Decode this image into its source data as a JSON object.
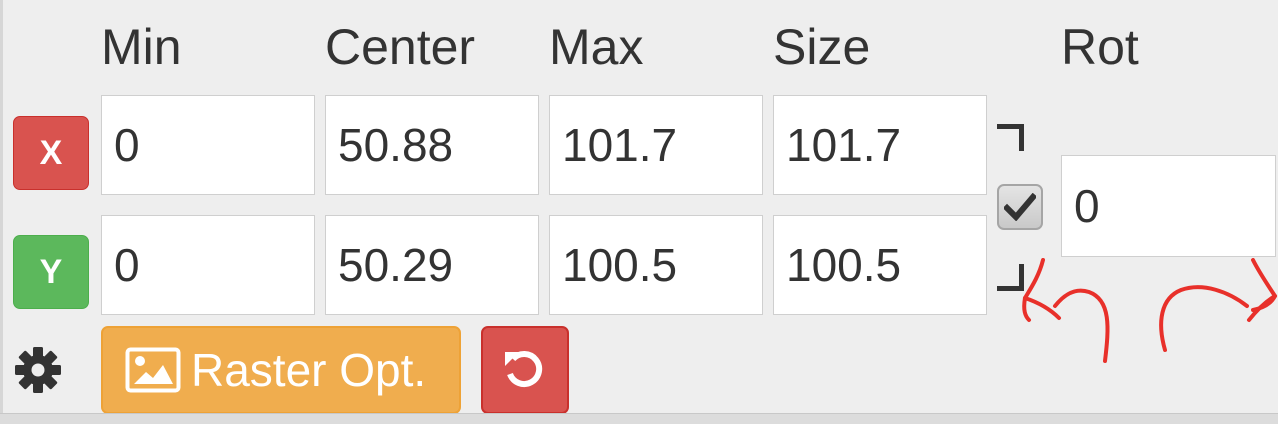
{
  "headers": {
    "min": "Min",
    "center": "Center",
    "max": "Max",
    "size": "Size",
    "rot": "Rot"
  },
  "axes": {
    "x": {
      "label": "X",
      "min": "0",
      "center": "50.88",
      "max": "101.7",
      "size": "101.7"
    },
    "y": {
      "label": "Y",
      "min": "0",
      "center": "50.29",
      "max": "100.5",
      "size": "100.5"
    }
  },
  "lock_aspect": {
    "checked": true,
    "icon": "check-icon"
  },
  "rotation": {
    "value": "0",
    "left_icon": "rotate-left-arrow-icon",
    "right_icon": "rotate-right-arrow-icon"
  },
  "toolbar": {
    "settings_icon": "gear-icon",
    "raster_label": "Raster Opt.",
    "raster_icon": "image-icon",
    "reset_icon": "undo-icon"
  },
  "colors": {
    "x_badge": "#d9534f",
    "y_badge": "#5cb85c",
    "raster_button": "#f0ad4e",
    "reset_button": "#d9534f",
    "rot_arrows": "#e8302a"
  }
}
